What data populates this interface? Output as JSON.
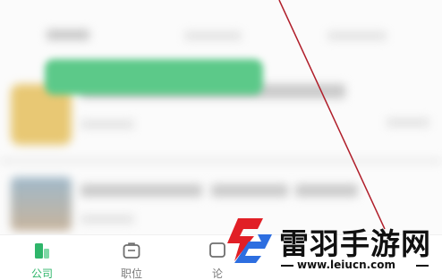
{
  "tabbar": {
    "items": [
      {
        "label": "公司",
        "icon": "company-building-icon",
        "active": true
      },
      {
        "label": "职位",
        "icon": "briefcase-icon",
        "active": false
      },
      {
        "label": "论",
        "icon": "comment-icon",
        "active": false
      }
    ]
  },
  "watermark": {
    "title": "雷羽手游网",
    "url": "www.leiucn.com",
    "logo": "lightning-logo"
  },
  "colors": {
    "accent_green": "#2fb56a",
    "toast_green": "#5cc989",
    "watermark_red": "#e11f26",
    "watermark_blue": "#2d6ee0",
    "diagonal_line": "#b01e2a"
  }
}
